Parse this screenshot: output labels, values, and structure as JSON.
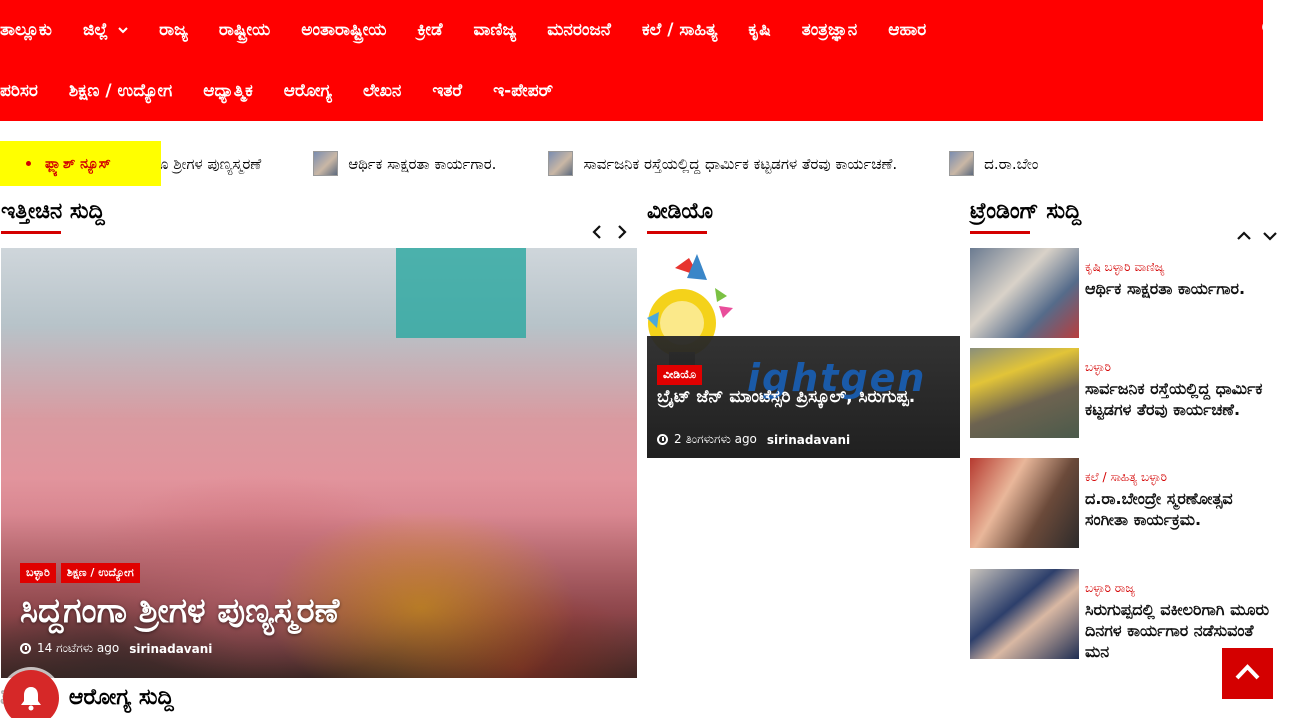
{
  "nav": {
    "row1": [
      "ತಾಲ್ಲೂಕು",
      "ಜಿಲ್ಲೆ",
      "ರಾಜ್ಯ",
      "ರಾಷ್ಟ್ರೀಯ",
      "ಅಂತಾರಾಷ್ಟ್ರೀಯ",
      "ಕ್ರೀಡೆ",
      "ವಾಣಿಜ್ಯ",
      "ಮನರಂಜನೆ",
      "ಕಲೆ / ಸಾಹಿತ್ಯ",
      "ಕೃಷಿ",
      "ತಂತ್ರಜ್ಞಾನ",
      "ಆಹಾರ"
    ],
    "row2": [
      "ಪರಿಸರ",
      "ಶಿಕ್ಷಣ / ಉದ್ಯೋಗ",
      "ಆಧ್ಯಾತ್ಮಿಕ",
      "ಆರೋಗ್ಯ",
      "ಲೇಖನ",
      "ಇತರೆ",
      "ಇ-ಪೇಪರ್"
    ],
    "dropdown_icon": "chevron-down-icon",
    "search_icon": "search-icon",
    "bg_color": "#ff0000"
  },
  "ticker": {
    "label": "ಫ್ಲ್ಯಾಶ್ ನ್ಯೂಸ್",
    "label_bg": "#ffff00",
    "items": [
      "ೂ ಶ್ರೀಗಳ ಪುಣ್ಯಸ್ಮರಣೆ",
      "ಆರ್ಥಿಕ ಸಾಕ್ಷರತಾ ಕಾರ್ಯಗಾರ.",
      "ಸಾರ್ವಜನಿಕ ರಸ್ತೆಯಲ್ಲಿದ್ದ ಧಾರ್ಮಿಕ ಕಟ್ಟಡಗಳ ತೆರವು ಕಾರ್ಯಚಣೆ.",
      "ದ.ರಾ.ಬೇಂ"
    ]
  },
  "latest": {
    "title": "ಇತ್ತೀಚಿನ ಸುದ್ದಿ",
    "prev_icon": "chevron-left-icon",
    "next_icon": "chevron-right-icon",
    "post": {
      "categories": [
        "ಬಳ್ಳಾರಿ",
        "ಶಿಕ್ಷಣ / ಉದ್ಯೋಗ"
      ],
      "title": "ಸಿದ್ದಗಂಗಾ ಶ್ರೀಗಳ ಪುಣ್ಯಸ್ಮರಣೆ",
      "time": "14 ಗಂಟೆಗಳು ago",
      "author": "sirinadavani"
    }
  },
  "video": {
    "title": "ವೀಡಿಯೊ",
    "post": {
      "category": "ವೀಡಿಯೊ",
      "title": "ಬ್ರೈಟ್ ಜೆನ್ ಮಾಂಟೆಸ್ಸರಿ ಪ್ರಿಸ್ಕೂಲ್, ಸಿರುಗುಪ್ಪ.",
      "time": "2 ತಿಂಗಳುಗಳು ago",
      "author": "sirinadavani",
      "brand_text": "ightgen"
    }
  },
  "trending": {
    "title": "ಟ್ರೆಂಡಿಂಗ್ ಸುದ್ದಿ",
    "up_icon": "chevron-up-icon",
    "down_icon": "chevron-down-icon",
    "items": [
      {
        "cats": "ಕೃಷಿ ಬಳ್ಳಾರಿ ವಾಣಿಜ್ಯ",
        "title": "ಆರ್ಥಿಕ ಸಾಕ್ಷರತಾ ಕಾರ್ಯಗಾರ."
      },
      {
        "cats": "ಬಳ್ಳಾರಿ",
        "title": "ಸಾರ್ವಜನಿಕ ರಸ್ತೆಯಲ್ಲಿದ್ದ ಧಾರ್ಮಿಕ ಕಟ್ಟಡಗಳ ತೆರವು ಕಾರ್ಯಚಣೆ."
      },
      {
        "cats": "ಕಲೆ / ಸಾಹಿತ್ಯ ಬಳ್ಳಾರಿ",
        "title": "ದ.ರಾ.ಬೇಂದ್ರೇ ಸ್ಮರಣೋತ್ಸವ ಸಂಗೀತಾ ಕಾರ್ಯಕ್ರಮ."
      },
      {
        "cats": "ಬಳ್ಳಾರಿ ರಾಜ್ಯ",
        "title": "ಸಿರುಗುಪ್ಪದಲ್ಲಿ ವಕೀಲರಿಗಾಗಿ ಮೂರು ದಿನಗಳ ಕಾರ್ಯಗಾರ ನಡೆಸುವಂತೆ ಮನ"
      }
    ]
  },
  "bottom": {
    "title": "ಶಿ ಮತ್ತು ಆರೋಗ್ಯ ಸುದ್ದಿ"
  },
  "widgets": {
    "bell_icon": "bell-icon",
    "back_to_top_icon": "chevron-up-icon",
    "accent": "#d40000"
  }
}
